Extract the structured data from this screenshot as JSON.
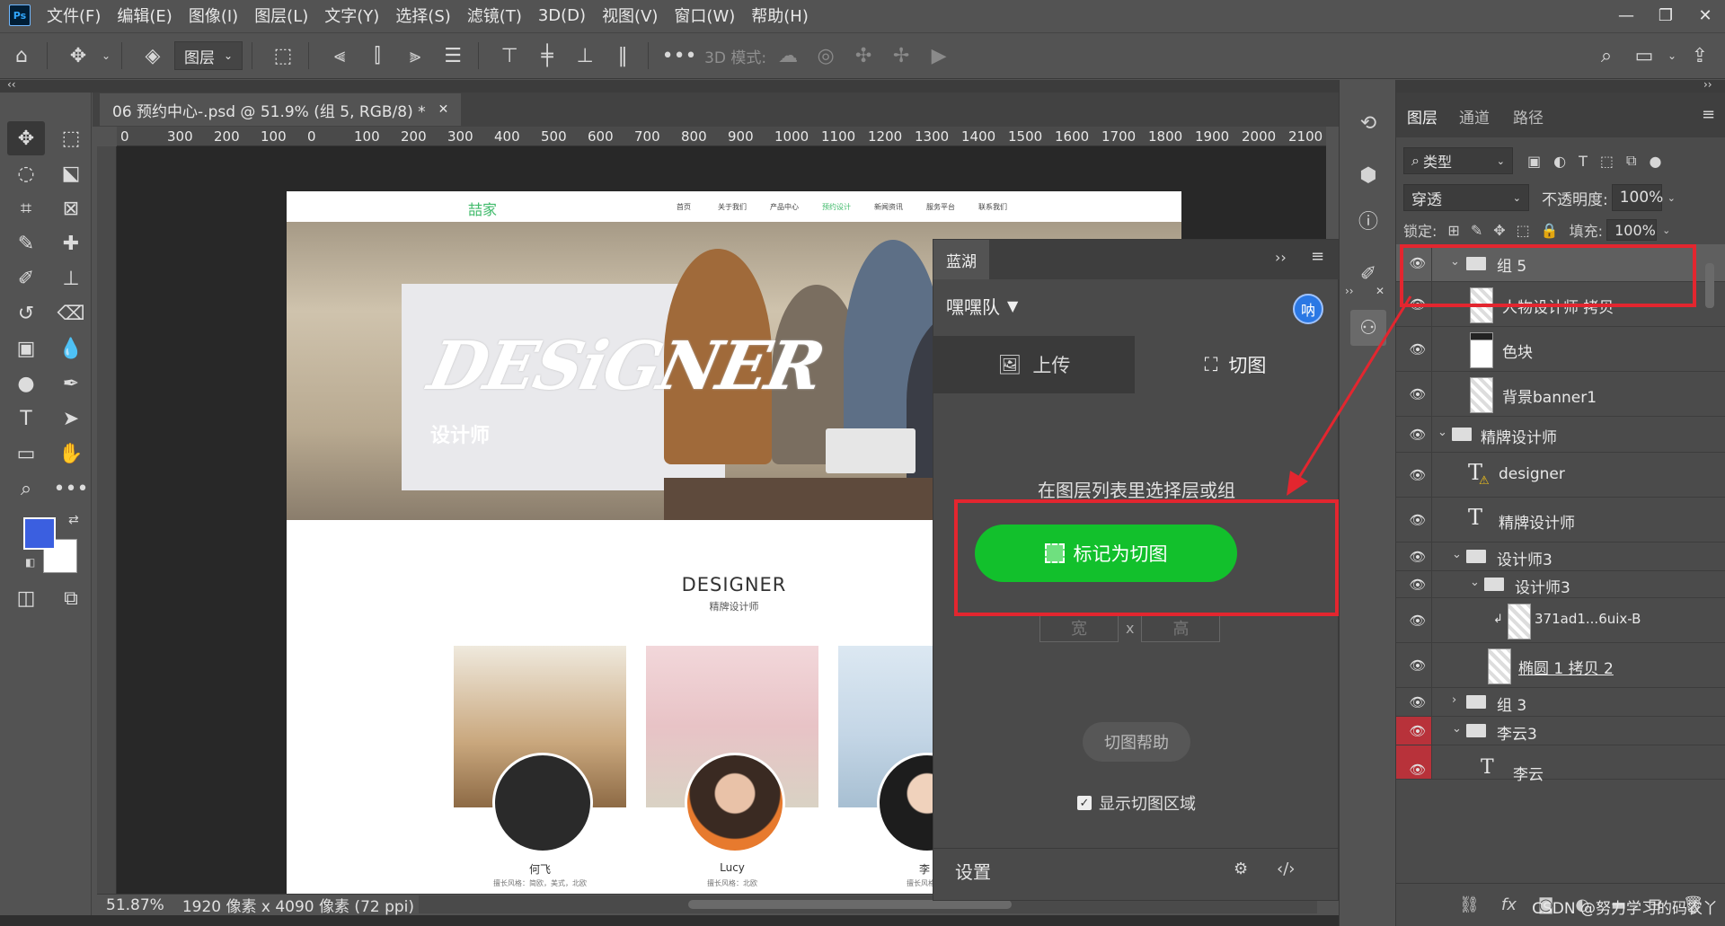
{
  "menubar": {
    "logo": "Ps",
    "items": [
      "文件(F)",
      "编辑(E)",
      "图像(I)",
      "图层(L)",
      "文字(Y)",
      "选择(S)",
      "滤镜(T)",
      "3D(D)",
      "视图(V)",
      "窗口(W)",
      "帮助(H)"
    ]
  },
  "optionsbar": {
    "layer_dropdown": "图层",
    "mode_3d_label": "3D 模式:"
  },
  "document": {
    "tab_title": "06 预约中心-.psd @ 51.9% (组 5, RGB/8) *",
    "ruler_ticks": [
      "0",
      "300",
      "200",
      "100",
      "0",
      "100",
      "200",
      "300",
      "400",
      "500",
      "600",
      "700",
      "800",
      "900",
      "1000",
      "1100",
      "1200",
      "1300",
      "1400",
      "1500",
      "1600",
      "1700",
      "1800",
      "1900",
      "2000",
      "2100"
    ],
    "status_zoom": "51.87%",
    "status_info": "1920 像素 x 4090 像素 (72 ppi)"
  },
  "site": {
    "logo": "喆家",
    "nav": [
      "首页",
      "关于我们",
      "产品中心",
      "预约设计",
      "新闻资讯",
      "服务平台",
      "联系我们"
    ],
    "banner_title": "DESiGNER",
    "banner_sub": "设计师",
    "section_title": "DESIGNER",
    "section_sub": "精牌设计师",
    "designers": [
      {
        "name": "何飞",
        "style": "擅长风格：简欧，美式，北欧"
      },
      {
        "name": "Lucy",
        "style": "擅长风格：北欧"
      },
      {
        "name": "李",
        "style": "擅长风格："
      }
    ]
  },
  "lanhu": {
    "tab": "蓝湖",
    "team": "嘿嘿队",
    "avatar": "呐",
    "upload_tab": "上传",
    "slice_tab": "切图",
    "hint": "在图层列表里选择层或组",
    "mark_button": "标记为切图",
    "width_placeholder": "宽",
    "x": "x",
    "height_placeholder": "高",
    "help_button": "切图帮助",
    "show_area": "显示切图区域",
    "settings": "设置"
  },
  "layers": {
    "tabs": [
      "图层",
      "通道",
      "路径"
    ],
    "filter": "类型",
    "blend": "穿透",
    "opacity_label": "不透明度:",
    "opacity": "100%",
    "lock_label": "锁定:",
    "fill_label": "填充:",
    "fill": "100%",
    "rows": [
      {
        "name": "组 5",
        "kind": "folder"
      },
      {
        "name": "人物设计师 拷贝",
        "kind": "image"
      },
      {
        "name": "色块",
        "kind": "image"
      },
      {
        "name": "背景banner1",
        "kind": "image"
      },
      {
        "name": "精牌设计师",
        "kind": "folder"
      },
      {
        "name": "designer",
        "kind": "text"
      },
      {
        "name": "精牌设计师",
        "kind": "text"
      },
      {
        "name": "设计师3",
        "kind": "folder"
      },
      {
        "name": "设计师3",
        "kind": "folder"
      },
      {
        "name": "371ad1...6uix-B",
        "kind": "image"
      },
      {
        "name": "椭圆 1 拷贝 2",
        "kind": "image"
      },
      {
        "name": "组 3",
        "kind": "folder"
      },
      {
        "name": "李云3",
        "kind": "folder"
      },
      {
        "name": "李云",
        "kind": "text"
      }
    ],
    "footer_fx": "fx"
  },
  "watermark": "CSDN @努力学习的码农丫",
  "colors": {
    "foreground": "#3b5fe0",
    "background": "#ffffff",
    "mark_button": "#12c02c",
    "highlight": "#e3262f"
  }
}
